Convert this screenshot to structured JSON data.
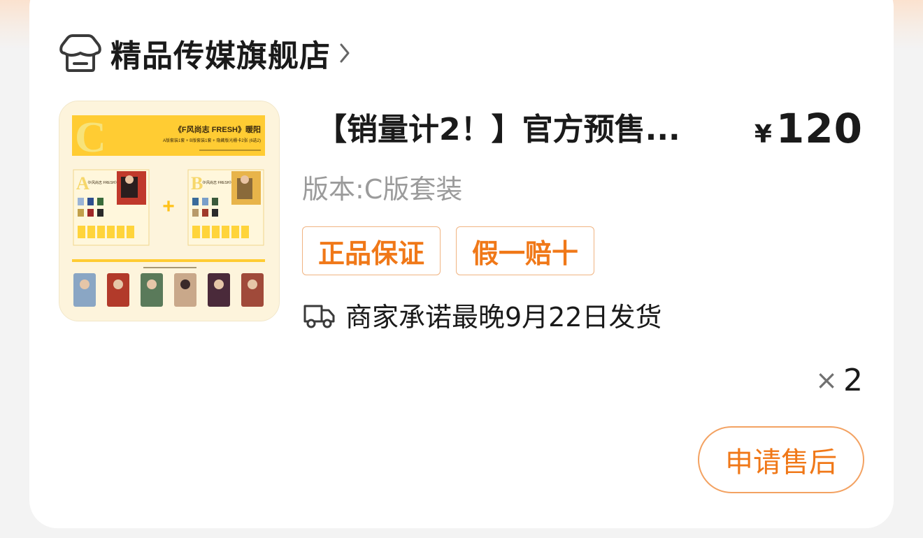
{
  "shop": {
    "name": "精品传媒旗舰店",
    "icon": "shop-icon"
  },
  "product": {
    "title": "【销量计2！】官方预售...",
    "currency": "¥",
    "price": "120",
    "variant": "版本:C版套装",
    "tags": [
      "正品保证",
      "假一赔十"
    ],
    "shipping": "商家承诺最晚9月22日发货",
    "quantity_symbol": "×",
    "quantity": "2",
    "image": {
      "letter": "C",
      "heading": "《F风尚志 FRESH》暖阳",
      "sub": "A版套装1套 + B版套装1套 + 隐藏版光栅卡2张 (6选2)",
      "panel_a_letter": "A",
      "panel_b_letter": "B",
      "panel_heading": "《F风尚志 FRESH》暖阳",
      "plus": "+"
    }
  },
  "actions": {
    "after_sale": "申请售后"
  },
  "colors": {
    "accent": "#f07818",
    "tag_border": "#f0b482",
    "text": "#1a1a1a",
    "muted": "#9b9b9b"
  }
}
